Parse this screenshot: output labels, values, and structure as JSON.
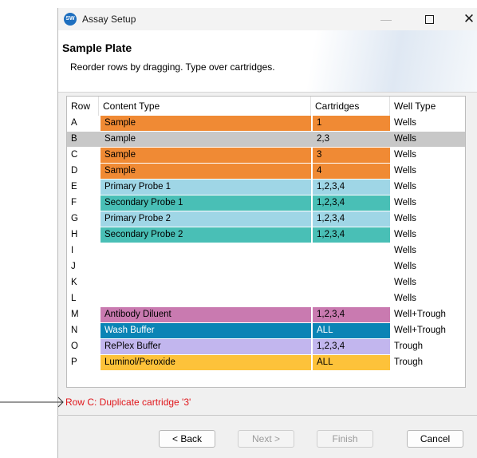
{
  "window": {
    "title": "Assay Setup",
    "icon_text": "SW",
    "controls": {
      "minimize": "—",
      "close": "✕"
    }
  },
  "header": {
    "title": "Sample Plate",
    "description": "Reorder rows by dragging. Type over cartridges."
  },
  "grid": {
    "columns": [
      "Row",
      "Content Type",
      "Cartridges",
      "Well Type"
    ],
    "rows": [
      {
        "row": "A",
        "type": "Sample",
        "cartridges": "1",
        "well": "Wells",
        "color": "#f08a34"
      },
      {
        "row": "B",
        "type": "Sample",
        "cartridges": "2,3",
        "well": "Wells",
        "color": "#c8c8c8",
        "selected": true
      },
      {
        "row": "C",
        "type": "Sample",
        "cartridges": "3",
        "well": "Wells",
        "color": "#f08a34"
      },
      {
        "row": "D",
        "type": "Sample",
        "cartridges": "4",
        "well": "Wells",
        "color": "#f08a34"
      },
      {
        "row": "E",
        "type": "Primary Probe 1",
        "cartridges": "1,2,3,4",
        "well": "Wells",
        "color": "#9fd6e6"
      },
      {
        "row": "F",
        "type": "Secondary Probe 1",
        "cartridges": "1,2,3,4",
        "well": "Wells",
        "color": "#49bfb6"
      },
      {
        "row": "G",
        "type": "Primary Probe 2",
        "cartridges": "1,2,3,4",
        "well": "Wells",
        "color": "#9fd6e6"
      },
      {
        "row": "H",
        "type": "Secondary Probe 2",
        "cartridges": "1,2,3,4",
        "well": "Wells",
        "color": "#49bfb6"
      },
      {
        "row": "I",
        "type": "",
        "cartridges": "",
        "well": "Wells",
        "color": ""
      },
      {
        "row": "J",
        "type": "",
        "cartridges": "",
        "well": "Wells",
        "color": ""
      },
      {
        "row": "K",
        "type": "",
        "cartridges": "",
        "well": "Wells",
        "color": ""
      },
      {
        "row": "L",
        "type": "",
        "cartridges": "",
        "well": "Wells",
        "color": ""
      },
      {
        "row": "M",
        "type": "Antibody Diluent",
        "cartridges": "1,2,3,4",
        "well": "Well+Trough",
        "color": "#c97ab0"
      },
      {
        "row": "N",
        "type": "Wash Buffer",
        "cartridges": "ALL",
        "well": "Well+Trough",
        "color": "#0a84b5",
        "text_color": "#ffffff"
      },
      {
        "row": "O",
        "type": "RePlex Buffer",
        "cartridges": "1,2,3,4",
        "well": "Trough",
        "color": "#c2b6ee"
      },
      {
        "row": "P",
        "type": "Luminol/Peroxide",
        "cartridges": "ALL",
        "well": "Trough",
        "color": "#fdc23a"
      }
    ]
  },
  "error": {
    "message": "Row C: Duplicate cartridge '3'",
    "color": "#e0161b"
  },
  "buttons": {
    "back": "< Back",
    "next": "Next >",
    "finish": "Finish",
    "cancel": "Cancel"
  }
}
